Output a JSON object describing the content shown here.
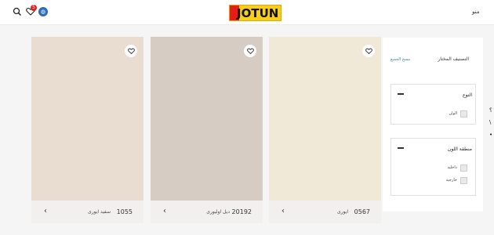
{
  "header": {
    "logo_text": "JOTUN",
    "wishlist_count": "5",
    "menu_label": "منو"
  },
  "colors": {
    "brand_red": "#e41d18",
    "brand_yellow": "#f7cf1b",
    "link": "#2f80b8"
  },
  "cards": [
    {
      "code": "1055",
      "name": "سفید ایوری",
      "swatch": "#e8ddd0"
    },
    {
      "code": "20192",
      "name": "دیل اولیوری",
      "swatch": "#d6ccc4"
    },
    {
      "code": "0567",
      "name": "ایوری",
      "swatch": "#f1e9d8"
    }
  ],
  "sidebar": {
    "title": "التصنیف المختار",
    "clear_label": "مسح الجمیع",
    "filters": [
      {
        "title": "النوع",
        "options": [
          "الوان"
        ]
      },
      {
        "title": "منطقة اللون",
        "options": [
          "داخلية",
          "خارجية"
        ]
      }
    ]
  }
}
